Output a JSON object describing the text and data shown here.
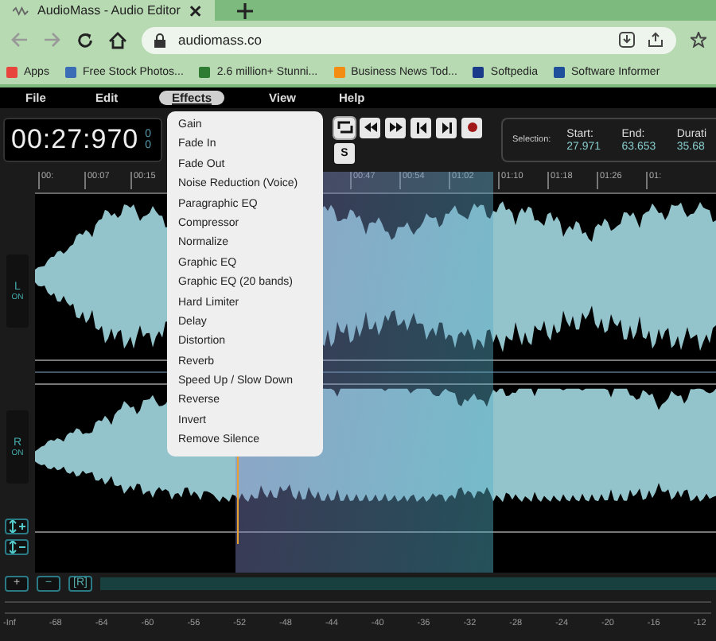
{
  "browser": {
    "tab_title": "AudioMass - Audio Editor",
    "url": "audiomass.co",
    "bookmarks": [
      {
        "label": "Apps",
        "color": "#e8453c"
      },
      {
        "label": "Free Stock Photos...",
        "color": "#3a6db5"
      },
      {
        "label": "2.6 million+ Stunni...",
        "color": "#2e7d32"
      },
      {
        "label": "Business News Tod...",
        "color": "#f28c13"
      },
      {
        "label": "Softpedia",
        "color": "#1a3a8a"
      },
      {
        "label": "Software Informer",
        "color": "#1f4e9a"
      }
    ]
  },
  "menu": [
    {
      "label": "File",
      "selected": false
    },
    {
      "label": "Edit",
      "selected": false
    },
    {
      "label": "Effects",
      "selected": true
    },
    {
      "label": "View",
      "selected": false
    },
    {
      "label": "Help",
      "selected": false
    }
  ],
  "time": "00:27:970",
  "time_side": [
    "0",
    "0"
  ],
  "transport": [
    {
      "kind": "loop"
    },
    {
      "kind": "rewind"
    },
    {
      "kind": "forward"
    },
    {
      "kind": "skip-start"
    },
    {
      "kind": "skip-end"
    },
    {
      "kind": "record"
    }
  ],
  "s_button": "S",
  "selection": {
    "label": "Selection:",
    "fields": [
      {
        "label": "Start:",
        "value": "27.971"
      },
      {
        "label": "End:",
        "value": "63.653"
      },
      {
        "label": "Durati",
        "value": "35.68"
      }
    ]
  },
  "ruler_left": [
    "00:",
    "00:07",
    "00:15"
  ],
  "ruler_right": [
    "00:47",
    "00:54",
    "01:02",
    "01:10",
    "01:18",
    "01:26",
    "01:"
  ],
  "channels": [
    {
      "name": "L",
      "state": "ON"
    },
    {
      "name": "R",
      "state": "ON"
    }
  ],
  "bottom_buttons": [
    "+",
    "−",
    "[R]"
  ],
  "effects_menu": [
    "Gain",
    "Fade In",
    "Fade Out",
    "Noise Reduction (Voice)",
    "Paragraphic EQ",
    "Compressor",
    "Normalize",
    "Graphic EQ",
    "Graphic EQ (20 bands)",
    "Hard Limiter",
    "Delay",
    "Distortion",
    "Reverb",
    "Speed Up / Slow Down",
    "Reverse",
    "Invert",
    "Remove Silence"
  ],
  "meter_labels": [
    "-Inf",
    "-68",
    "-64",
    "-60",
    "-56",
    "-52",
    "-48",
    "-44",
    "-40",
    "-36",
    "-32",
    "-28",
    "-24",
    "-20",
    "-16",
    "-12"
  ]
}
